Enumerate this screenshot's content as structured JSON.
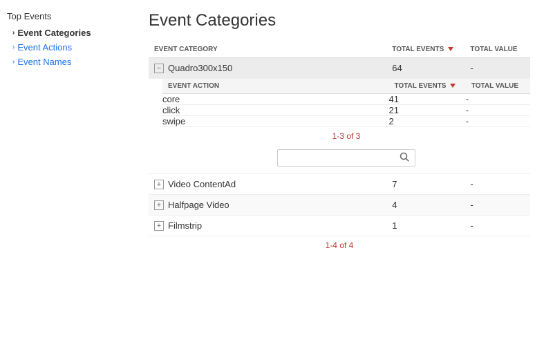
{
  "sidebar": {
    "section_title": "Top Events",
    "items": [
      {
        "id": "event-categories",
        "label": "Event Categories",
        "active": true
      },
      {
        "id": "event-actions",
        "label": "Event Actions",
        "active": false
      },
      {
        "id": "event-names",
        "label": "Event Names",
        "active": false
      }
    ]
  },
  "main": {
    "page_title": "Event Categories",
    "outer_table": {
      "columns": [
        {
          "id": "event-category",
          "label": "EVENT CATEGORY",
          "sortable": false
        },
        {
          "id": "total-events",
          "label": "TOTAL EVENTS",
          "sortable": true
        },
        {
          "id": "total-value",
          "label": "TOTAL VALUE",
          "sortable": false
        }
      ],
      "rows": [
        {
          "id": "quadro",
          "name": "Quadro300x150",
          "total_events": "64",
          "total_value": "-",
          "expanded": true,
          "expand_icon": "−",
          "inner_table": {
            "columns": [
              {
                "id": "event-action",
                "label": "EVENT ACTION",
                "sortable": false
              },
              {
                "id": "total-events",
                "label": "TOTAL EVENTS",
                "sortable": true
              },
              {
                "id": "total-value",
                "label": "TOTAL VALUE",
                "sortable": false
              }
            ],
            "rows": [
              {
                "name": "core",
                "total_events": "41",
                "total_value": "-"
              },
              {
                "name": "click",
                "total_events": "21",
                "total_value": "-"
              },
              {
                "name": "swipe",
                "total_events": "2",
                "total_value": "-"
              }
            ],
            "pagination": "1-3 of 3",
            "search_placeholder": ""
          }
        },
        {
          "id": "video-content-ad",
          "name": "Video ContentAd",
          "total_events": "7",
          "total_value": "-",
          "expanded": false,
          "expand_icon": "+"
        },
        {
          "id": "halfpage-video",
          "name": "Halfpage Video",
          "total_events": "4",
          "total_value": "-",
          "expanded": false,
          "expand_icon": "+"
        },
        {
          "id": "filmstrip",
          "name": "Filmstrip",
          "total_events": "1",
          "total_value": "-",
          "expanded": false,
          "expand_icon": "+"
        }
      ],
      "pagination": "1-4 of 4"
    }
  }
}
